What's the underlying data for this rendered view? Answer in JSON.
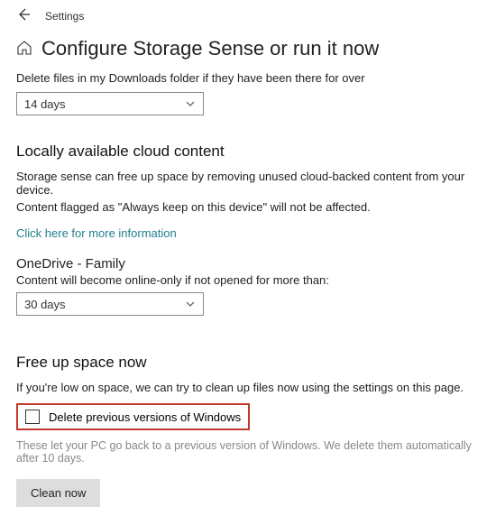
{
  "header": {
    "app": "Settings",
    "title": "Configure Storage Sense or run it now"
  },
  "downloads": {
    "desc": "Delete files in my Downloads folder if they have been there for over",
    "value": "14 days"
  },
  "cloud": {
    "heading": "Locally available cloud content",
    "line1": "Storage sense can free up space by removing unused cloud-backed content from your device.",
    "line2": "Content flagged as \"Always keep on this device\" will not be affected.",
    "link": "Click here for more information",
    "onedrive_label": "OneDrive - Family",
    "onedrive_desc": "Content will become online-only if not opened for more than:",
    "onedrive_value": "30 days"
  },
  "freeup": {
    "heading": "Free up space now",
    "desc": "If you're low on space, we can try to clean up files now using the settings on this page.",
    "checkbox_label": "Delete previous versions of Windows",
    "note": "These let your PC go back to a previous version of Windows. We delete them automatically after 10 days.",
    "button": "Clean now"
  }
}
